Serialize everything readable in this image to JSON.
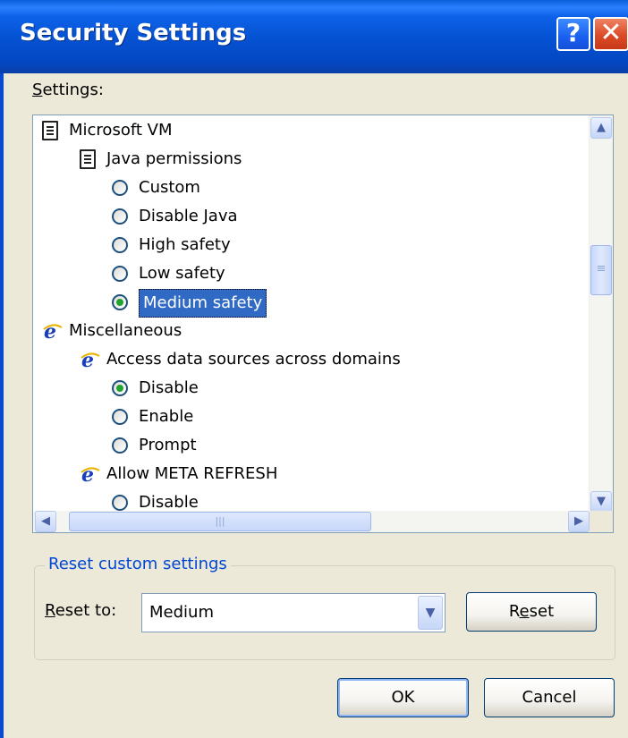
{
  "window": {
    "title": "Security Settings",
    "help_glyph": "?",
    "close_glyph": "✕"
  },
  "settings": {
    "label": "Settings:",
    "tree": [
      {
        "type": "category",
        "icon": "document-icon",
        "label": "Microsoft VM"
      },
      {
        "type": "setting",
        "icon": "document-icon",
        "label": "Java permissions"
      },
      {
        "type": "option",
        "label": "Custom",
        "checked": false
      },
      {
        "type": "option",
        "label": "Disable Java",
        "checked": false
      },
      {
        "type": "option",
        "label": "High safety",
        "checked": false
      },
      {
        "type": "option",
        "label": "Low safety",
        "checked": false
      },
      {
        "type": "option",
        "label": "Medium safety",
        "checked": true,
        "selected": true
      },
      {
        "type": "category",
        "icon": "ie-icon",
        "label": "Miscellaneous"
      },
      {
        "type": "setting",
        "icon": "ie-icon",
        "label": "Access data sources across domains"
      },
      {
        "type": "option",
        "label": "Disable",
        "checked": true
      },
      {
        "type": "option",
        "label": "Enable",
        "checked": false
      },
      {
        "type": "option",
        "label": "Prompt",
        "checked": false
      },
      {
        "type": "setting",
        "icon": "ie-icon",
        "label": "Allow META REFRESH"
      },
      {
        "type": "option",
        "label": "Disable",
        "checked": false
      }
    ]
  },
  "reset_group": {
    "title": "Reset custom settings",
    "reset_to_label": "Reset to:",
    "selected_level": "Medium",
    "reset_button": "Reset"
  },
  "footer": {
    "ok": "OK",
    "cancel": "Cancel"
  },
  "colors": {
    "titlebar": "#0553d4",
    "dialog_bg": "#ece9d8",
    "group_title": "#0046d5",
    "selection": "#316ac5",
    "radio_dot": "#22a32f"
  }
}
